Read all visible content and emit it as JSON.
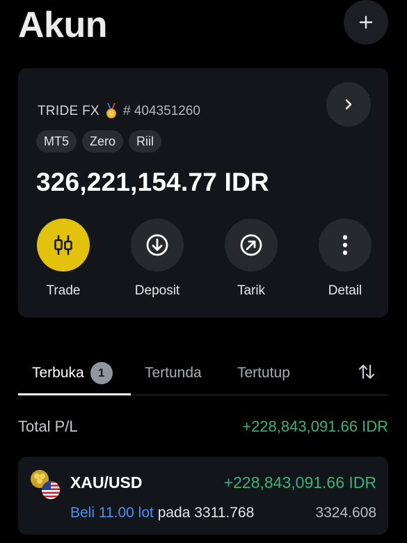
{
  "header": {
    "title": "Akun",
    "add_icon": "plus-icon"
  },
  "account": {
    "name": "TRIDE FX",
    "medal_icon": "medal-icon",
    "number": "# 404351260",
    "tags": [
      "MT5",
      "Zero",
      "Riil"
    ],
    "balance": "326,221,154.77 IDR",
    "actions": [
      {
        "label": "Trade",
        "icon": "candlestick-icon"
      },
      {
        "label": "Deposit",
        "icon": "arrow-down-circle-icon"
      },
      {
        "label": "Tarik",
        "icon": "arrow-up-right-circle-icon"
      },
      {
        "label": "Detail",
        "icon": "more-vertical-icon"
      }
    ]
  },
  "tabs": {
    "items": [
      {
        "label": "Terbuka",
        "badge": "1",
        "active": true
      },
      {
        "label": "Tertunda",
        "active": false
      },
      {
        "label": "Tertutup",
        "active": false
      }
    ],
    "sort_icon": "sort-arrows-icon"
  },
  "summary": {
    "label": "Total P/L",
    "value": "+228,843,091.66 IDR"
  },
  "positions": [
    {
      "symbol": "XAU/USD",
      "pl": "+228,843,091.66 IDR",
      "side": "Beli 11.00 lot",
      "at_text": "pada 3311.768",
      "current_price": "3324.608"
    }
  ],
  "colors": {
    "accent": "#e2c20c",
    "profit": "#3cb37a",
    "buy": "#4d8ff0",
    "card": "#12161a",
    "background": "#000000"
  }
}
